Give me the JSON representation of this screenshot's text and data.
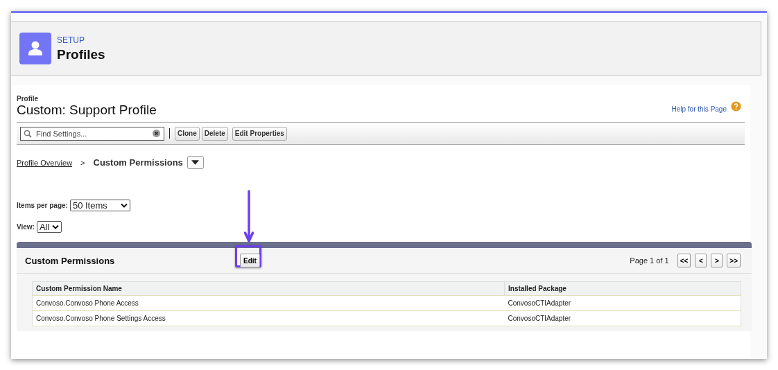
{
  "header": {
    "eyebrow": "SETUP",
    "title": "Profiles"
  },
  "profile": {
    "label": "Profile",
    "name": "Custom: Support Profile",
    "help_link": "Help for this Page"
  },
  "toolbar": {
    "search": {
      "placeholder": "Find Settings..."
    },
    "buttons": [
      "Clone",
      "Delete",
      "Edit Properties"
    ]
  },
  "breadcrumb": {
    "link": "Profile Overview",
    "separator": ">",
    "current": "Custom Permissions"
  },
  "items_per_page": {
    "label": "Items per page:",
    "value": "50 Items"
  },
  "view": {
    "label": "View:",
    "value": "All"
  },
  "section": {
    "title": "Custom Permissions",
    "edit_button": "Edit",
    "page_info": "Page 1 of 1",
    "pager": [
      "<<",
      "<",
      ">",
      ">>"
    ]
  },
  "table": {
    "columns": [
      "Custom Permission Name",
      "Installed Package"
    ],
    "rows": [
      [
        "Convoso.Convoso Phone Access",
        "ConvosoCTIAdapter"
      ],
      [
        "Convoso.Convoso Phone Settings Access",
        "ConvosoCTIAdapter"
      ]
    ]
  }
}
